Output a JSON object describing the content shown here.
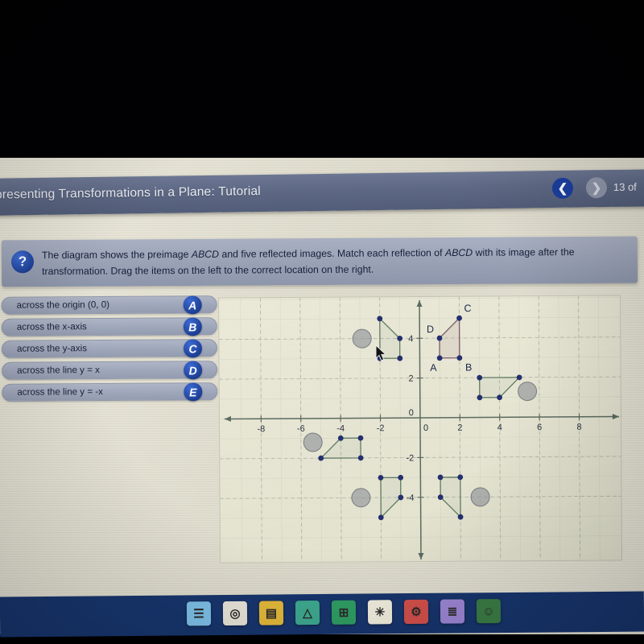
{
  "header": {
    "title": "presenting Transformations in a Plane: Tutorial",
    "prev_icon": "chevron-left-icon",
    "next_icon": "chevron-right-icon",
    "page_count": "13 of"
  },
  "question": {
    "help_icon": "?",
    "line1_a": "The diagram shows the preimage ",
    "line1_b": "ABCD",
    "line1_c": " and five reflected images. Match each reflection of ",
    "line1_d": "ABCD",
    "line1_e": " with its image after",
    "line2": "the transformation. Drag the items on the left to the correct location on the right."
  },
  "drag_items": [
    {
      "label": "across the origin (0, 0)",
      "badge": "A"
    },
    {
      "label": "across the x-axis",
      "badge": "B"
    },
    {
      "label": "across the y-axis",
      "badge": "C"
    },
    {
      "label": "across the line y = x",
      "badge": "D"
    },
    {
      "label": "across the line y = -x",
      "badge": "E"
    }
  ],
  "chart_data": {
    "type": "scatter",
    "title": "",
    "xlabel": "",
    "ylabel": "",
    "xlim": [
      -9.5,
      9.5
    ],
    "ylim": [
      -6.2,
      6.2
    ],
    "grid": true,
    "x_ticks": [
      -8,
      -6,
      -4,
      -2,
      0,
      2,
      4,
      6,
      8
    ],
    "y_ticks": [
      4,
      2,
      0,
      -2,
      -4
    ],
    "origin_label": "0",
    "axis_color": "#5c6b60",
    "point_color": "#24306e",
    "preimage_edge_color": "#7a5a68",
    "image_edge_color": "#5f7a62",
    "polygons": [
      {
        "name": "preimage-ABCD",
        "is_preimage": true,
        "vertices": [
          [
            1,
            3
          ],
          [
            2,
            3
          ],
          [
            2,
            5
          ],
          [
            1,
            4
          ]
        ],
        "vertex_labels": [
          {
            "text": "A",
            "x": 1,
            "y": 3,
            "dx": -12,
            "dy": 16
          },
          {
            "text": "B",
            "x": 2,
            "y": 3,
            "dx": 7,
            "dy": 16
          },
          {
            "text": "C",
            "x": 2,
            "y": 5,
            "dx": 6,
            "dy": -8
          },
          {
            "text": "D",
            "x": 1,
            "y": 4,
            "dx": -16,
            "dy": -7
          }
        ]
      },
      {
        "name": "image-reflect-y-axis",
        "is_preimage": false,
        "vertices": [
          [
            -1,
            3
          ],
          [
            -2,
            3
          ],
          [
            -2,
            5
          ],
          [
            -1,
            4
          ]
        ],
        "vertex_labels": []
      },
      {
        "name": "image-reflect-y-eq-x",
        "is_preimage": false,
        "vertices": [
          [
            3,
            1
          ],
          [
            3,
            2
          ],
          [
            5,
            2
          ],
          [
            4,
            1
          ]
        ],
        "vertex_labels": []
      },
      {
        "name": "image-reflect-y-eq-neg-x",
        "is_preimage": false,
        "vertices": [
          [
            -3,
            -1
          ],
          [
            -3,
            -2
          ],
          [
            -5,
            -2
          ],
          [
            -4,
            -1
          ]
        ],
        "vertex_labels": []
      },
      {
        "name": "image-reflect-origin",
        "is_preimage": false,
        "vertices": [
          [
            -1,
            -3
          ],
          [
            -2,
            -3
          ],
          [
            -2,
            -5
          ],
          [
            -1,
            -4
          ]
        ],
        "vertex_labels": []
      },
      {
        "name": "image-reflect-x-axis",
        "is_preimage": false,
        "vertices": [
          [
            1,
            -3
          ],
          [
            2,
            -3
          ],
          [
            2,
            -5
          ],
          [
            1,
            -4
          ]
        ],
        "vertex_labels": []
      }
    ],
    "drop_targets": [
      {
        "name": "drop-target-1",
        "x": -2.9,
        "y": 4.0
      },
      {
        "name": "drop-target-2",
        "x": 5.4,
        "y": 1.3
      },
      {
        "name": "drop-target-3",
        "x": -5.4,
        "y": -1.2
      },
      {
        "name": "drop-target-4",
        "x": -3.0,
        "y": -4.0
      },
      {
        "name": "drop-target-5",
        "x": 3.0,
        "y": -4.0
      }
    ]
  },
  "taskbar": {
    "items": [
      {
        "name": "docs-icon",
        "glyph": "☰",
        "color": "#7ec0e8"
      },
      {
        "name": "chrome-icon",
        "glyph": "◎",
        "color": "#e8e4d8"
      },
      {
        "name": "slides-icon",
        "glyph": "▤",
        "color": "#e3b93a"
      },
      {
        "name": "drive-icon",
        "glyph": "△",
        "color": "#3ea98f"
      },
      {
        "name": "sheets-icon",
        "glyph": "⊞",
        "color": "#2f9d63"
      },
      {
        "name": "star-icon",
        "glyph": "✳",
        "color": "#f2efdf"
      },
      {
        "name": "forms-icon",
        "glyph": "⚙",
        "color": "#d4504c"
      },
      {
        "name": "keep-icon",
        "glyph": "≣",
        "color": "#9d87d6"
      },
      {
        "name": "classroom-icon",
        "glyph": "☺",
        "color": "#3b7d46"
      }
    ]
  }
}
